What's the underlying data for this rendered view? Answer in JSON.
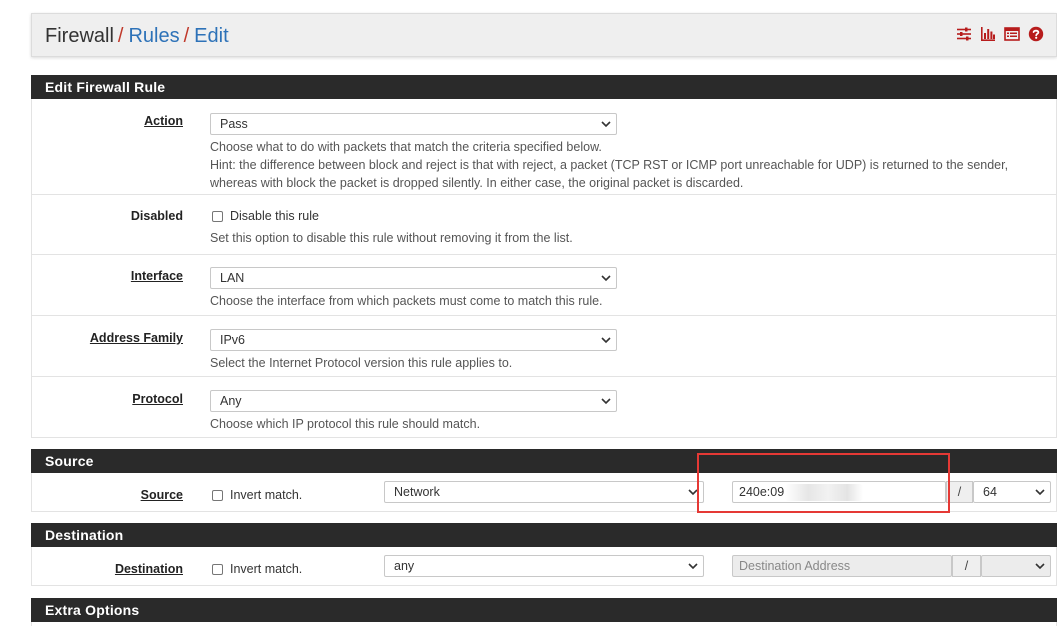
{
  "breadcrumb": {
    "root": "Firewall",
    "separator": "/",
    "level2": "Rules",
    "level3": "Edit"
  },
  "toolbar": {
    "icons": [
      "sliders-icon",
      "bar-chart-icon",
      "list-icon",
      "help-icon"
    ],
    "icon_color": "#b71c1c"
  },
  "colors": {
    "panel_header_bg": "#2a2a2a",
    "link": "#2d72b8",
    "separator": "#c0392b",
    "highlight": "#e53935"
  },
  "edit_rule": {
    "title": "Edit Firewall Rule",
    "action": {
      "label": "Action",
      "value": "Pass",
      "help1": "Choose what to do with packets that match the criteria specified below.",
      "help2": "Hint: the difference between block and reject is that with reject, a packet (TCP RST or ICMP port unreachable for UDP) is returned to the sender,",
      "help3": "whereas with block the packet is dropped silently. In either case, the original packet is discarded."
    },
    "disabled": {
      "label": "Disabled",
      "checkbox_label": "Disable this rule",
      "help": "Set this option to disable this rule without removing it from the list."
    },
    "interface": {
      "label": "Interface",
      "value": "LAN",
      "help": "Choose the interface from which packets must come to match this rule."
    },
    "address_family": {
      "label": "Address Family",
      "value": "IPv6",
      "help": "Select the Internet Protocol version this rule applies to."
    },
    "protocol": {
      "label": "Protocol",
      "value": "Any",
      "help": "Choose which IP protocol this rule should match."
    }
  },
  "source": {
    "title": "Source",
    "label": "Source",
    "invert_label": "Invert match.",
    "type_value": "Network",
    "address_value": "240e:09",
    "slash": "/",
    "mask_value": "64"
  },
  "destination": {
    "title": "Destination",
    "label": "Destination",
    "invert_label": "Invert match.",
    "type_value": "any",
    "address_placeholder": "Destination Address",
    "slash": "/",
    "mask_value": ""
  },
  "extra": {
    "title": "Extra Options"
  }
}
